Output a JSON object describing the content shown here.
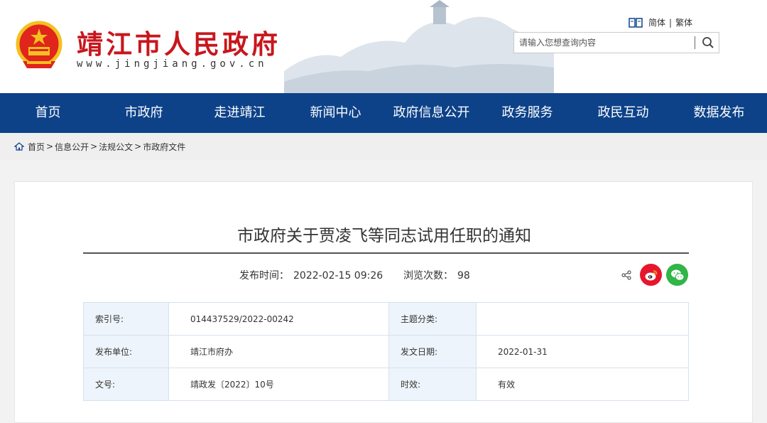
{
  "header": {
    "site_name": "靖江市人民政府",
    "site_url": "www.jingjiang.gov.cn",
    "lang": {
      "simplified": "简体",
      "separator": "|",
      "traditional": "繁体"
    },
    "search": {
      "placeholder": "请输入您想查询内容",
      "icon": "search-icon"
    },
    "brand_color": "#c8161d"
  },
  "nav": {
    "color": "#0d4289",
    "items": [
      "首页",
      "市政府",
      "走进靖江",
      "新闻中心",
      "政府信息公开",
      "政务服务",
      "政民互动",
      "数据发布"
    ]
  },
  "breadcrumb": {
    "items": [
      "首页",
      "信息公开",
      "法规公文",
      "市政府文件"
    ],
    "separator": ">"
  },
  "article": {
    "title": "市政府关于贾凌飞等同志试用任职的通知",
    "pub_label": "发布时间：",
    "pub_value": "2022-02-15 09:26",
    "views_label": "浏览次数：",
    "views_value": "98",
    "share_icons": [
      "share-icon",
      "weibo-icon",
      "wechat-icon"
    ]
  },
  "info_table": {
    "rows": [
      {
        "label1": "索引号:",
        "value1": "014437529/2022-00242",
        "label2": "主题分类:",
        "value2": ""
      },
      {
        "label1": "发布单位:",
        "value1": "靖江市府办",
        "label2": "发文日期:",
        "value2": "2022-01-31"
      },
      {
        "label1": "文号:",
        "value1": "靖政发〔2022〕10号",
        "label2": "时效:",
        "value2": "有效"
      }
    ]
  }
}
